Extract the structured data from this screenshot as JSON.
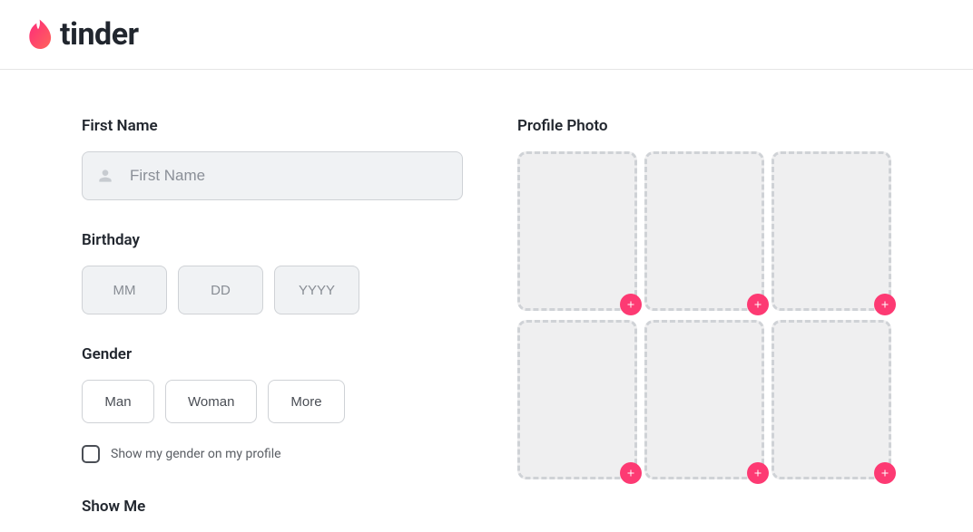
{
  "brand": {
    "name": "tinder",
    "flame_gradient_start": "#fd297b",
    "flame_gradient_end": "#ff655b"
  },
  "form": {
    "first_name": {
      "label": "First Name",
      "placeholder": "First Name",
      "value": ""
    },
    "birthday": {
      "label": "Birthday",
      "month_placeholder": "MM",
      "day_placeholder": "DD",
      "year_placeholder": "YYYY"
    },
    "gender": {
      "label": "Gender",
      "options": [
        "Man",
        "Woman",
        "More"
      ],
      "show_on_profile_label": "Show my gender on my profile",
      "show_on_profile_checked": false
    },
    "show_me": {
      "label": "Show Me"
    }
  },
  "photo": {
    "label": "Profile Photo",
    "slots": 6
  }
}
